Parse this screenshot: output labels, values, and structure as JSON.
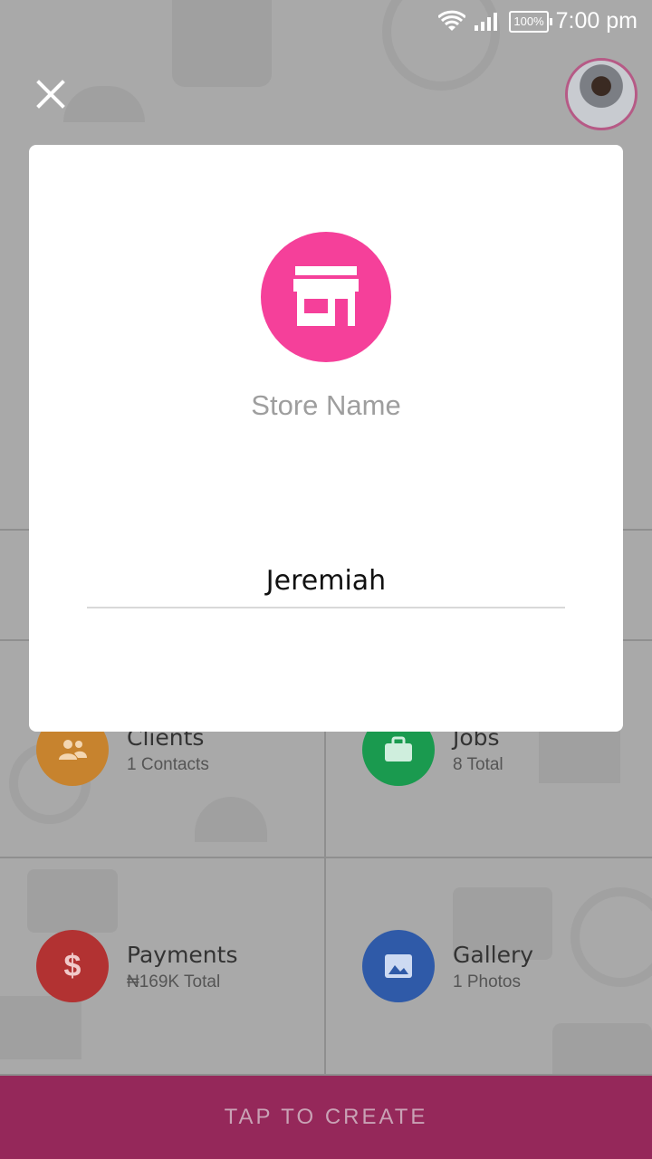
{
  "status_bar": {
    "time": "7:00 pm",
    "battery": "100%"
  },
  "icons": {
    "close": "close-icon",
    "avatar": "avatar",
    "store": "store-icon",
    "clients": "people-icon",
    "jobs": "briefcase-icon",
    "payments": "dollar-icon",
    "gallery": "image-icon"
  },
  "dialog": {
    "title": "Store Name",
    "input_value": "Jeremiah"
  },
  "tiles": [
    {
      "title": "Clients",
      "subtitle": "1 Contacts",
      "color": "#e89527"
    },
    {
      "title": "Jobs",
      "subtitle": "8 Total",
      "color": "#16a34a"
    },
    {
      "title": "Payments",
      "subtitle": "₦169K Total",
      "color": "#c62828"
    },
    {
      "title": "Gallery",
      "subtitle": "1 Photos",
      "color": "#2f5fc4"
    }
  ],
  "bottom_button": {
    "label": "TAP TO CREATE"
  },
  "colors": {
    "accent": "#f5409a",
    "bottom_bar": "#95285a",
    "overlay": "#a9a9a9"
  }
}
